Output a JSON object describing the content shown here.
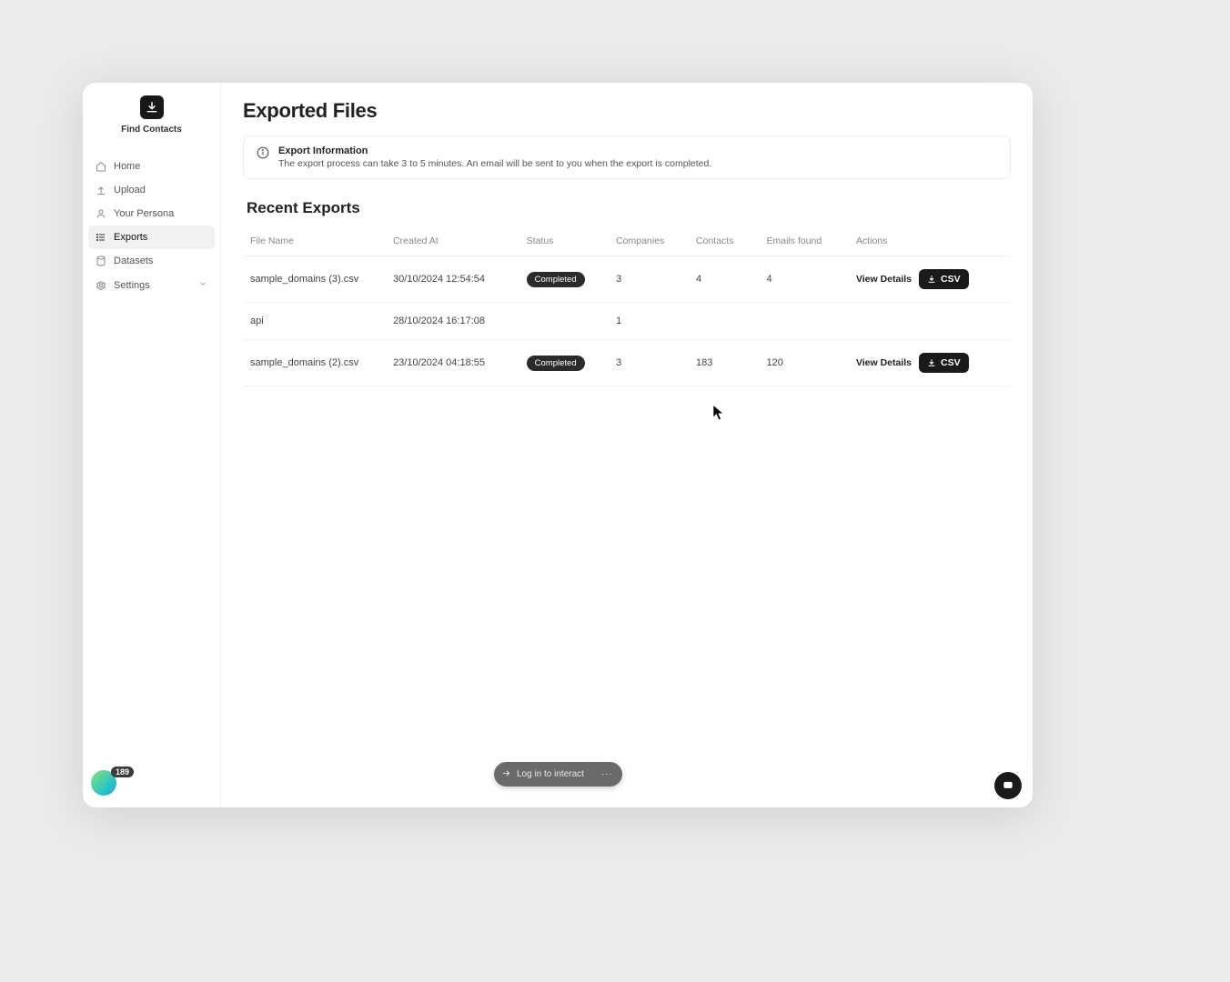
{
  "app": {
    "name": "Find Contacts"
  },
  "sidebar": {
    "items": [
      {
        "label": "Home"
      },
      {
        "label": "Upload"
      },
      {
        "label": "Your Persona"
      },
      {
        "label": "Exports"
      },
      {
        "label": "Datasets"
      },
      {
        "label": "Settings"
      }
    ]
  },
  "page": {
    "title": "Exported Files",
    "info_title": "Export Information",
    "info_body": "The export process can take 3 to 5 minutes. An email will be sent to you when the export is completed.",
    "section_title": "Recent Exports"
  },
  "table": {
    "headers": {
      "file": "File Name",
      "created": "Created At",
      "status": "Status",
      "companies": "Companies",
      "contacts": "Contacts",
      "emails": "Emails found",
      "actions": "Actions"
    },
    "rows": [
      {
        "file": "sample_domains (3).csv",
        "created": "30/10/2024 12:54:54",
        "status": "Completed",
        "companies": "3",
        "contacts": "4",
        "emails": "4",
        "has_actions": true
      },
      {
        "file": "api",
        "created": "28/10/2024 16:17:08",
        "status": "",
        "companies": "1",
        "contacts": "",
        "emails": "",
        "has_actions": false
      },
      {
        "file": "sample_domains (2).csv",
        "created": "23/10/2024 04:18:55",
        "status": "Completed",
        "companies": "3",
        "contacts": "183",
        "emails": "120",
        "has_actions": true
      }
    ],
    "actions": {
      "view": "View Details",
      "csv": "CSV"
    }
  },
  "widgets": {
    "badge_count": "189",
    "login_pill": "Log in to interact"
  }
}
